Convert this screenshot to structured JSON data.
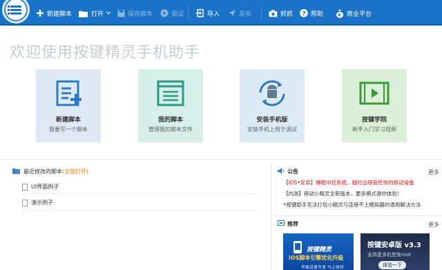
{
  "toolbar": {
    "new_script": "新建脚本",
    "open": "打开",
    "save_script": "保存脚本",
    "debug": "调试",
    "import": "导入",
    "publish": "发布",
    "capture": "抓抓",
    "help": "帮助",
    "business": "商业平台"
  },
  "welcome": "欢迎使用按键精灵手机助手",
  "cards": [
    {
      "title": "新建脚本",
      "subtitle": "我要写一个脚本"
    },
    {
      "title": "我的脚本",
      "subtitle": "管理我的脚本文件"
    },
    {
      "title": "安装手机版",
      "subtitle": "安装手机上用于调试"
    },
    {
      "title": "按键学院",
      "subtitle": "新手入门学习视频"
    }
  ],
  "recent": {
    "title": "最近修改的脚本",
    "open_all": "(全部打开)",
    "files": [
      "UI界面例子",
      "演示例子"
    ]
  },
  "announce": {
    "title": "公告",
    "more": "更多",
    "items": [
      {
        "red": "【iOS•安卓】睡眠中控系统，随时远程管控你的移动设备",
        "text": ""
      },
      {
        "red": "",
        "text": "【内测】移动小精灵全新版本，更多模式邀你体验！"
      },
      {
        "red": "",
        "text": "•按键助手无法打包小精灵与连接不上模拟器的通用解决方法"
      }
    ]
  },
  "recommend": {
    "title": "推荐",
    "more": "更多",
    "ad1": {
      "title": "按键精灵",
      "headline": "iOS脚本引擎优化升级",
      "tagline": "苹果设备专享 马上体验"
    },
    "ad2": {
      "title": "按键安卓版 v3.3",
      "line": "支持更多机型免root",
      "button": "体验一下"
    }
  }
}
